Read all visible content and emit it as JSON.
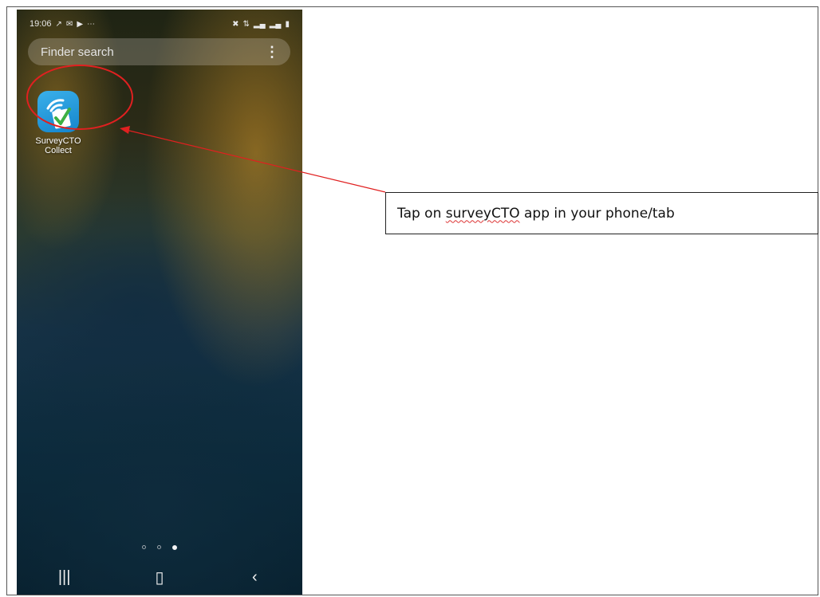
{
  "status_bar": {
    "time": "19:06",
    "left_icons": [
      "missed-call-icon",
      "message-icon",
      "youtube-icon",
      "more-icon"
    ],
    "right_icons": [
      "mute-icon",
      "4g-icon",
      "signal-icon",
      "signal-icon",
      "battery-icon"
    ]
  },
  "search": {
    "placeholder": "Finder search"
  },
  "apps": [
    {
      "label_line1": "SurveyCTO",
      "label_line2": "Collect",
      "icon": "surveycto-app-icon"
    }
  ],
  "page_indicator": {
    "count": 3,
    "active_index": 2
  },
  "nav": {
    "recents": "recents-icon",
    "home": "home-icon",
    "back": "back-icon"
  },
  "callout": {
    "text_before": "Tap on ",
    "text_squiggle": "surveyCTO",
    "text_after": " app in your phone/tab"
  },
  "colors": {
    "annotation_red": "#e02020",
    "app_blue": "#1e90d8"
  }
}
